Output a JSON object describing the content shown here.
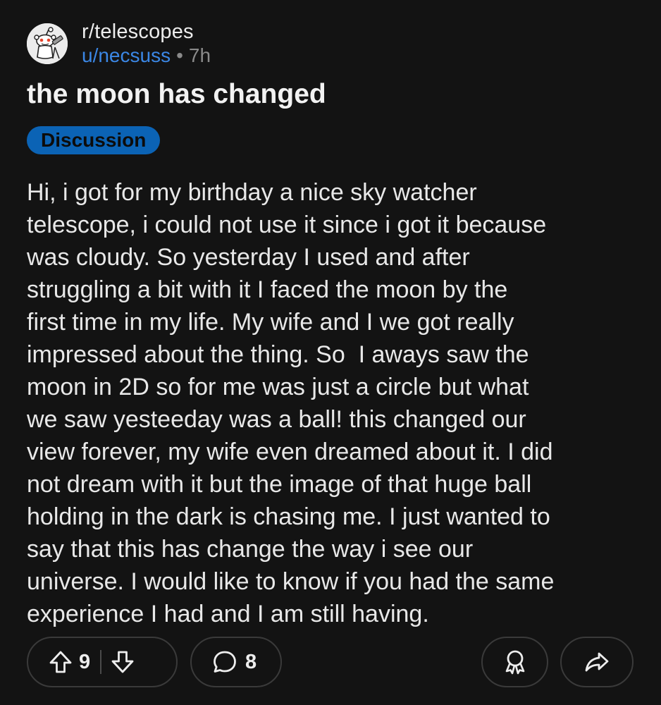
{
  "post": {
    "subreddit": "r/telescopes",
    "username": "u/necsuss",
    "separator": "•",
    "time": "7h",
    "title": "the moon has changed",
    "flair": "Discussion",
    "body": "Hi, i got for my birthday a nice sky watcher\ntelescope, i could not use it since i got it because\nwas cloudy. So yesterday I used and after\nstruggling a bit with it I faced the moon by the\nfirst time in my life. My wife and I we got really\nimpressed about the thing. So  I aways saw the\nmoon in 2D so for me was just a circle but what\nwe saw yesteeday was a ball! this changed our\nview forever, my wife even dreamed about it. I did\nnot dream with it but the image of that huge ball\nholding in the dark is chasing me. I just wanted to\nsay that this has change the way i see our\nuniverse. I would like to know if you had the same\nexperience I had and I am still having."
  },
  "actions": {
    "upvotes": "9",
    "comments": "8"
  },
  "icons": {
    "avatar": "reddit-snoo-avatar",
    "upvote": "arrow-up-icon",
    "downvote": "arrow-down-icon",
    "comment": "speech-bubble-icon",
    "award": "award-ribbon-icon",
    "share": "share-arrow-icon"
  },
  "colors": {
    "background": "#131313",
    "username": "#3b87e5",
    "flair_bg": "#0b63b5",
    "pill_border": "#3a3a3a",
    "text": "#e8e8e8"
  }
}
